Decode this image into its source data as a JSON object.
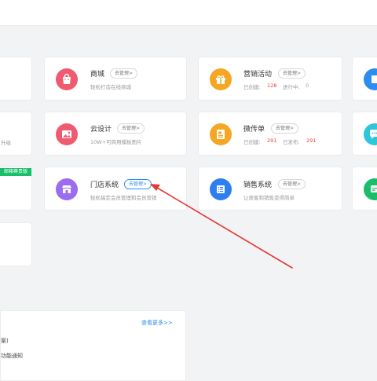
{
  "colors": {
    "accent": "#2d8cf0",
    "highlight_red": "#e8413b",
    "badge_green": "#19be6b",
    "annotation_arrow": "#e53935"
  },
  "left_column": {
    "partial_text": "升级",
    "badge": "邮箱尊贵版"
  },
  "apps": {
    "mall": {
      "icon": "shopping-bag-icon",
      "title": "商城",
      "manage": "去管理>",
      "desc": "轻松打造在线商城"
    },
    "marketing": {
      "icon": "gift-icon",
      "title": "营销活动",
      "manage": "去管理>",
      "created_label": "已创建:",
      "created_value": "128",
      "running_label": "进行中:",
      "running_value": "0"
    },
    "cloud_design": {
      "icon": "image-icon",
      "title": "云设计",
      "manage": "去管理>",
      "desc": "10W+可商用模板图片"
    },
    "flyer": {
      "icon": "document-icon",
      "title": "微传单",
      "manage": "去管理>",
      "created_label": "已创建:",
      "created_value": "291",
      "published_label": "已发布:",
      "published_value": "291"
    },
    "store": {
      "icon": "store-icon",
      "title": "门店系统",
      "manage": "去管理>",
      "desc": "轻松搞定会员管理和会员营销"
    },
    "sales": {
      "icon": "list-icon",
      "title": "销售系统",
      "manage": "去管理>",
      "desc": "让获客和销售变得简单"
    }
  },
  "bottom_panel": {
    "more_link": "查看更多>>",
    "line1": "案)",
    "line2": "功能通知"
  }
}
